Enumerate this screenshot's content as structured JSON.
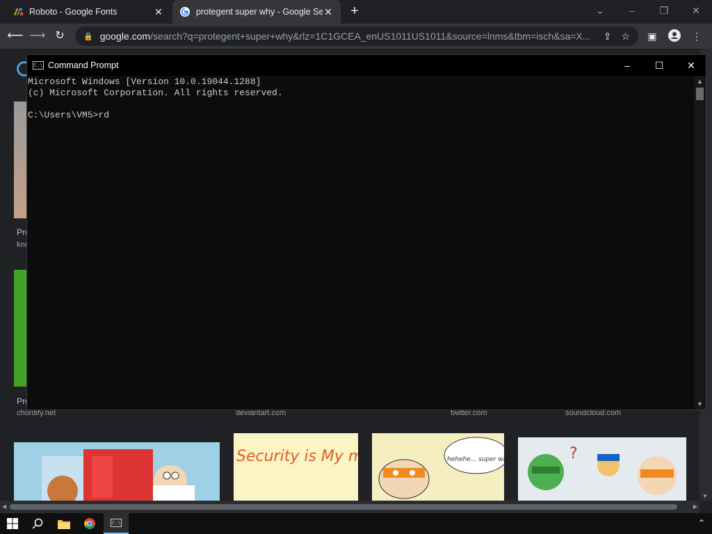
{
  "browser": {
    "tabs": [
      {
        "title": "Roboto - Google Fonts",
        "active": false
      },
      {
        "title": "protegent super why - Google Se",
        "active": true
      }
    ],
    "url_domain": "google.com",
    "url_rest": "/search?q=protegent+super+why&rlz=1C1GCEA_enUS1011US1011&source=lnms&tbm=isch&sa=X..."
  },
  "page": {
    "partial_titles": [
      "Pro",
      "kno",
      "Pro"
    ],
    "sources": [
      "chordify.net",
      "deviantart.com",
      "twitter.com",
      "soundcloud.com"
    ],
    "thumbs": [
      {
        "art": "Security is My mot-NO!"
      },
      {
        "art": "hehehe... super why? Who's that???"
      }
    ]
  },
  "cmd": {
    "title": "Command Prompt",
    "lines": [
      "Microsoft Windows [Version 10.0.19044.1288]",
      "(c) Microsoft Corporation. All rights reserved.",
      "",
      "C:\\Users\\VM5>rd"
    ]
  },
  "icons": {
    "back": "arrow-left-icon",
    "forward": "arrow-right-icon",
    "reload": "reload-icon"
  },
  "colors": {
    "accent": "#76b9ed",
    "console_text": "#cccccc"
  }
}
